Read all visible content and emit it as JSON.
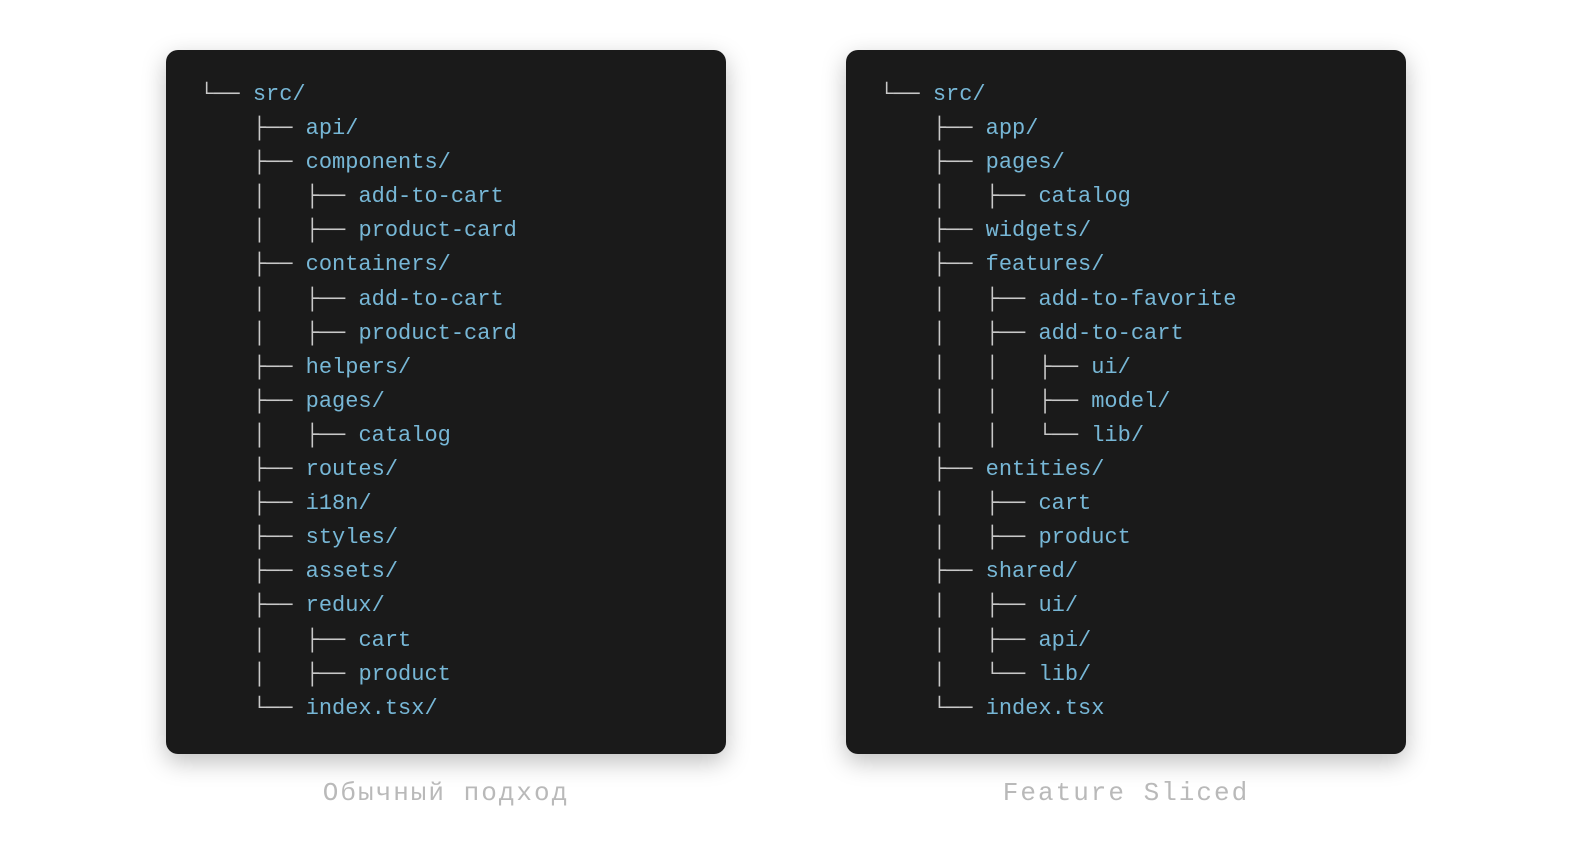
{
  "left": {
    "caption": "Обычный подход",
    "lines": [
      {
        "prefix": "└── ",
        "name": "src/"
      },
      {
        "prefix": "    ├── ",
        "name": "api/"
      },
      {
        "prefix": "    ├── ",
        "name": "components/"
      },
      {
        "prefix": "    │   ├── ",
        "name": "add-to-cart"
      },
      {
        "prefix": "    │   ├── ",
        "name": "product-card"
      },
      {
        "prefix": "    ├── ",
        "name": "containers/"
      },
      {
        "prefix": "    │   ├── ",
        "name": "add-to-cart"
      },
      {
        "prefix": "    │   ├── ",
        "name": "product-card"
      },
      {
        "prefix": "    ├── ",
        "name": "helpers/"
      },
      {
        "prefix": "    ├── ",
        "name": "pages/"
      },
      {
        "prefix": "    │   ├── ",
        "name": "catalog"
      },
      {
        "prefix": "    ├── ",
        "name": "routes/"
      },
      {
        "prefix": "    ├── ",
        "name": "i18n/"
      },
      {
        "prefix": "    ├── ",
        "name": "styles/"
      },
      {
        "prefix": "    ├── ",
        "name": "assets/"
      },
      {
        "prefix": "    ├── ",
        "name": "redux/"
      },
      {
        "prefix": "    │   ├── ",
        "name": "cart"
      },
      {
        "prefix": "    │   ├── ",
        "name": "product"
      },
      {
        "prefix": "    └── ",
        "name": "index.tsx/"
      }
    ]
  },
  "right": {
    "caption": "Feature Sliced",
    "lines": [
      {
        "prefix": "└── ",
        "name": "src/"
      },
      {
        "prefix": "    ├── ",
        "name": "app/"
      },
      {
        "prefix": "    ├── ",
        "name": "pages/"
      },
      {
        "prefix": "    │   ├── ",
        "name": "catalog"
      },
      {
        "prefix": "    ├── ",
        "name": "widgets/"
      },
      {
        "prefix": "    ├── ",
        "name": "features/"
      },
      {
        "prefix": "    │   ├── ",
        "name": "add-to-favorite"
      },
      {
        "prefix": "    │   ├── ",
        "name": "add-to-cart"
      },
      {
        "prefix": "    │   │   ├── ",
        "name": "ui/"
      },
      {
        "prefix": "    │   │   ├── ",
        "name": "model/"
      },
      {
        "prefix": "    │   │   └── ",
        "name": "lib/"
      },
      {
        "prefix": "    ├── ",
        "name": "entities/"
      },
      {
        "prefix": "    │   ├── ",
        "name": "cart"
      },
      {
        "prefix": "    │   ├── ",
        "name": "product"
      },
      {
        "prefix": "    ├── ",
        "name": "shared/"
      },
      {
        "prefix": "    │   ├── ",
        "name": "ui/"
      },
      {
        "prefix": "    │   ├── ",
        "name": "api/"
      },
      {
        "prefix": "    │   └── ",
        "name": "lib/"
      },
      {
        "prefix": "    └── ",
        "name": "index.tsx"
      }
    ]
  }
}
